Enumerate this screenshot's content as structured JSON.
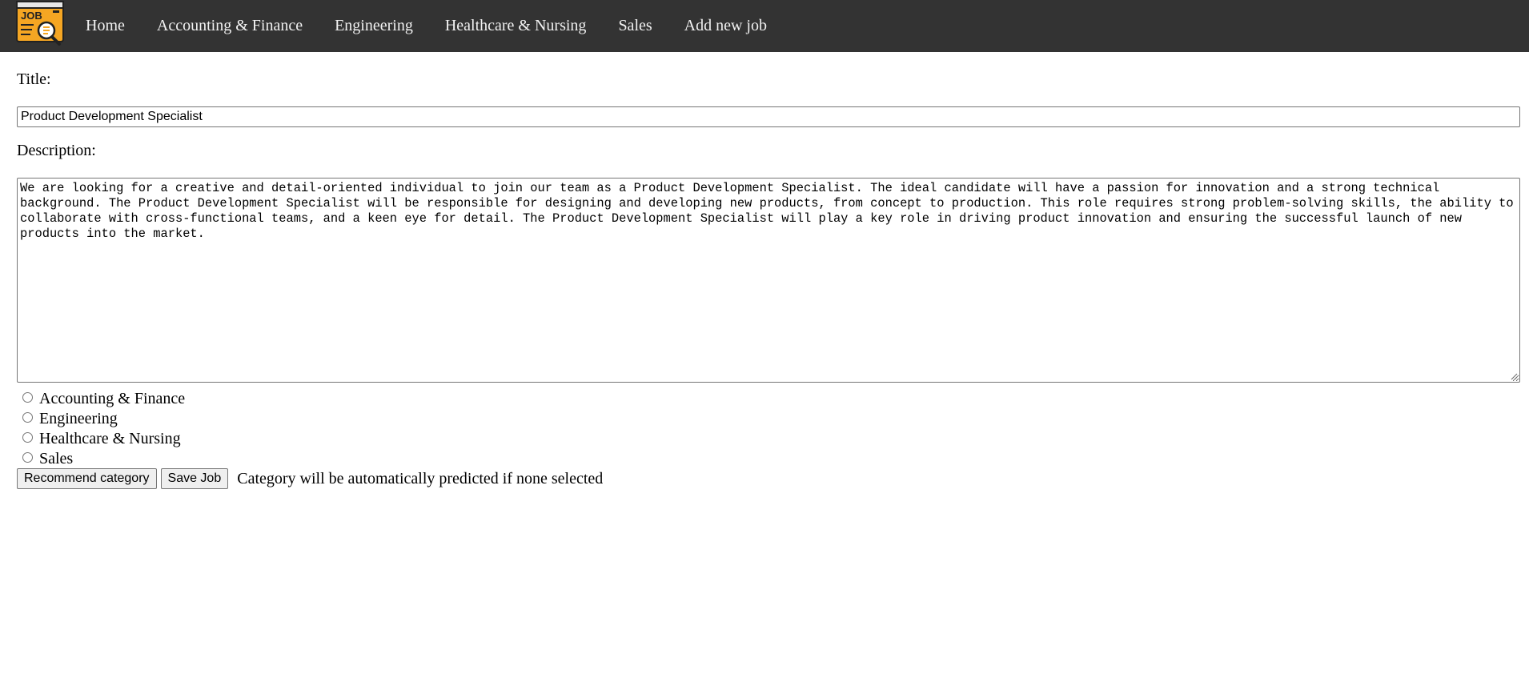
{
  "nav": {
    "logo_text": "JOB",
    "items": [
      {
        "label": "Home"
      },
      {
        "label": "Accounting & Finance"
      },
      {
        "label": "Engineering"
      },
      {
        "label": "Healthcare & Nursing"
      },
      {
        "label": "Sales"
      },
      {
        "label": "Add new job"
      }
    ]
  },
  "form": {
    "title_label": "Title:",
    "title_value": "Product Development Specialist",
    "description_label": "Description:",
    "description_value": "We are looking for a creative and detail-oriented individual to join our team as a Product Development Specialist. The ideal candidate will have a passion for innovation and a strong technical background. The Product Development Specialist will be responsible for designing and developing new products, from concept to production. This role requires strong problem-solving skills, the ability to collaborate with cross-functional teams, and a keen eye for detail. The Product Development Specialist will play a key role in driving product innovation and ensuring the successful launch of new products into the market.",
    "categories": [
      {
        "label": "Accounting & Finance",
        "checked": false
      },
      {
        "label": "Engineering",
        "checked": false
      },
      {
        "label": "Healthcare & Nursing",
        "checked": false
      },
      {
        "label": "Sales",
        "checked": false
      }
    ],
    "recommend_button": "Recommend category",
    "save_button": "Save Job",
    "hint": "Category will be automatically predicted if none selected"
  },
  "colors": {
    "nav_bg": "#333333",
    "nav_text": "#f2f2f2",
    "logo_orange": "#f5a623"
  }
}
